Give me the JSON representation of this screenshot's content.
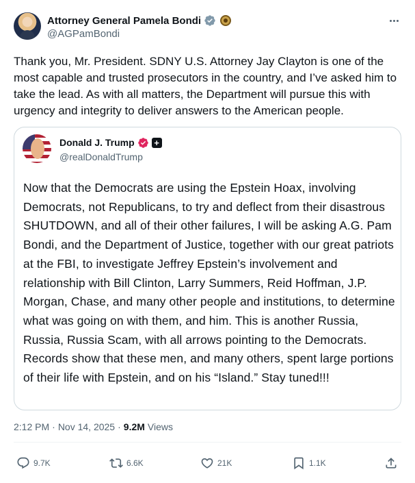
{
  "author": {
    "name": "Attorney General Pamela Bondi",
    "handle": "@AGPamBondi"
  },
  "post": {
    "text": "Thank you, Mr. President. SDNY U.S. Attorney Jay Clayton is one of the most capable and trusted prosecutors in the country, and I’ve asked him to take the lead. As with all matters, the Department will pursue this with urgency and integrity to deliver answers to the American people."
  },
  "quoted": {
    "name": "Donald J. Trump",
    "handle": "@realDonaldTrump",
    "text": "Now that the Democrats are using the Epstein Hoax, involving Democrats, not Republicans, to try and deflect from their disastrous SHUTDOWN, and all of their other failures, I will be asking A.G. Pam Bondi, and the Department of Justice, together with our great patriots at the FBI, to investigate Jeffrey Epstein’s involvement and relationship with Bill Clinton, Larry Summers, Reid Hoffman, J.P. Morgan, Chase, and many other people and institutions, to determine what was going on with them, and him. This is another Russia, Russia, Russia Scam, with all arrows pointing to the Democrats. Records show that these men, and many others, spent large portions of their life with Epstein, and on his “Island.” Stay tuned!!!"
  },
  "meta": {
    "time": "2:12 PM",
    "separator": "·",
    "date": "Nov 14, 2025",
    "views_count": "9.2M",
    "views_label": "Views"
  },
  "actions": {
    "replies": "9.7K",
    "reposts": "6.6K",
    "likes": "21K",
    "bookmarks": "1.1K"
  },
  "colors": {
    "text": "#0f1419",
    "secondary": "#536471",
    "border": "#cfd9de",
    "verified_blue": "#1d9bf0",
    "verified_pink": "#e0245e"
  },
  "icons": {
    "more": "more-icon",
    "reply": "reply-icon",
    "repost": "repost-icon",
    "like": "heart-icon",
    "bookmark": "bookmark-icon",
    "share": "share-icon"
  }
}
